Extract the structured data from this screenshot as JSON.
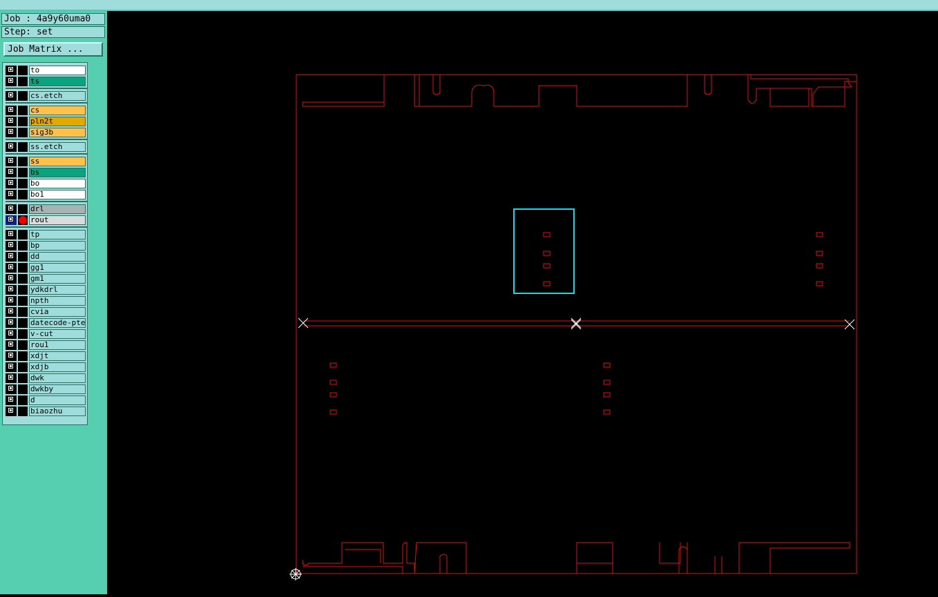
{
  "header": {
    "job": "Job : 4a9y60uma0",
    "step": "Step: set",
    "job_matrix_label": "Job Matrix ..."
  },
  "layers": [
    {
      "name": "to",
      "color": "#ffffff"
    },
    {
      "name": "ts",
      "color": "#0aa37f"
    },
    {
      "name": "cs.etch",
      "color": "#9fdcdc"
    },
    {
      "name": "cs",
      "color": "#ffc04c"
    },
    {
      "name": "pln2t",
      "color": "#e0a800"
    },
    {
      "name": "sig3b",
      "color": "#ffc04c"
    },
    {
      "name": "ss.etch",
      "color": "#9fdcdc"
    },
    {
      "name": "ss",
      "color": "#ffc04c"
    },
    {
      "name": "bs",
      "color": "#0aa37f"
    },
    {
      "name": "bo",
      "color": "#ffffff"
    },
    {
      "name": "bo1",
      "color": "#ffffff"
    },
    {
      "name": "drl",
      "color": "#a8b4b4"
    },
    {
      "name": "rout",
      "color": "#d8dcdc",
      "active": true
    },
    {
      "name": "tp",
      "color": "#9fdcdc"
    },
    {
      "name": "bp",
      "color": "#9fdcdc"
    },
    {
      "name": "dd",
      "color": "#9fdcdc"
    },
    {
      "name": "gg1",
      "color": "#9fdcdc"
    },
    {
      "name": "gm1",
      "color": "#9fdcdc"
    },
    {
      "name": "ydkdrl",
      "color": "#9fdcdc"
    },
    {
      "name": "npth",
      "color": "#9fdcdc"
    },
    {
      "name": "cvia",
      "color": "#9fdcdc"
    },
    {
      "name": "datecode-pte",
      "color": "#9fdcdc"
    },
    {
      "name": "v-cut",
      "color": "#9fdcdc"
    },
    {
      "name": "rou1",
      "color": "#9fdcdc"
    },
    {
      "name": "xdjt",
      "color": "#9fdcdc"
    },
    {
      "name": "xdjb",
      "color": "#9fdcdc"
    },
    {
      "name": "dwk",
      "color": "#9fdcdc"
    },
    {
      "name": "dwkby",
      "color": "#9fdcdc"
    },
    {
      "name": "d",
      "color": "#9fdcdc"
    },
    {
      "name": "biaozhu",
      "color": "#9fdcdc"
    }
  ],
  "colors": {
    "rout_outline": "#e01010",
    "highlight": "#00e0f0",
    "marker": "#ffffff",
    "panel": "#55cfb0"
  }
}
